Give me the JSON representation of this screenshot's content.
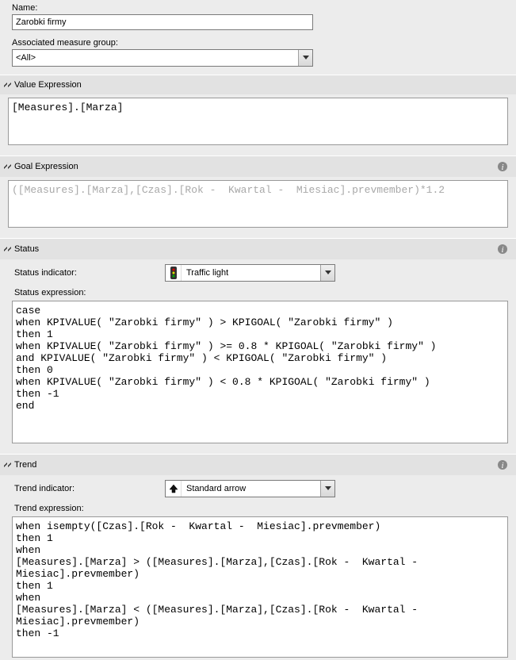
{
  "name": {
    "label": "Name:",
    "value": "Zarobki firmy"
  },
  "measure_group": {
    "label": "Associated measure group:",
    "value": "<All>"
  },
  "value_expr": {
    "title": "Value Expression",
    "text": "[Measures].[Marza]"
  },
  "goal_expr": {
    "title": "Goal Expression",
    "text": "([Measures].[Marza],[Czas].[Rok -  Kwartal -  Miesiac].prevmember)*1.2"
  },
  "status": {
    "title": "Status",
    "indicator_label": "Status indicator:",
    "indicator_value": "Traffic light",
    "expression_label": "Status expression:",
    "expression_text": "case\nwhen KPIVALUE( \"Zarobki firmy\" ) > KPIGOAL( \"Zarobki firmy\" )\nthen 1\nwhen KPIVALUE( \"Zarobki firmy\" ) >= 0.8 * KPIGOAL( \"Zarobki firmy\" )\nand KPIVALUE( \"Zarobki firmy\" ) < KPIGOAL( \"Zarobki firmy\" )\nthen 0\nwhen KPIVALUE( \"Zarobki firmy\" ) < 0.8 * KPIGOAL( \"Zarobki firmy\" )\nthen -1\nend"
  },
  "trend": {
    "title": "Trend",
    "indicator_label": "Trend indicator:",
    "indicator_value": "Standard arrow",
    "expression_label": "Trend expression:",
    "expression_text": "when isempty([Czas].[Rok -  Kwartal -  Miesiac].prevmember)\nthen 1\nwhen\n[Measures].[Marza] > ([Measures].[Marza],[Czas].[Rok -  Kwartal -  \nMiesiac].prevmember)\nthen 1\nwhen\n[Measures].[Marza] < ([Measures].[Marza],[Czas].[Rok -  Kwartal -  \nMiesiac].prevmember)\nthen -1"
  }
}
